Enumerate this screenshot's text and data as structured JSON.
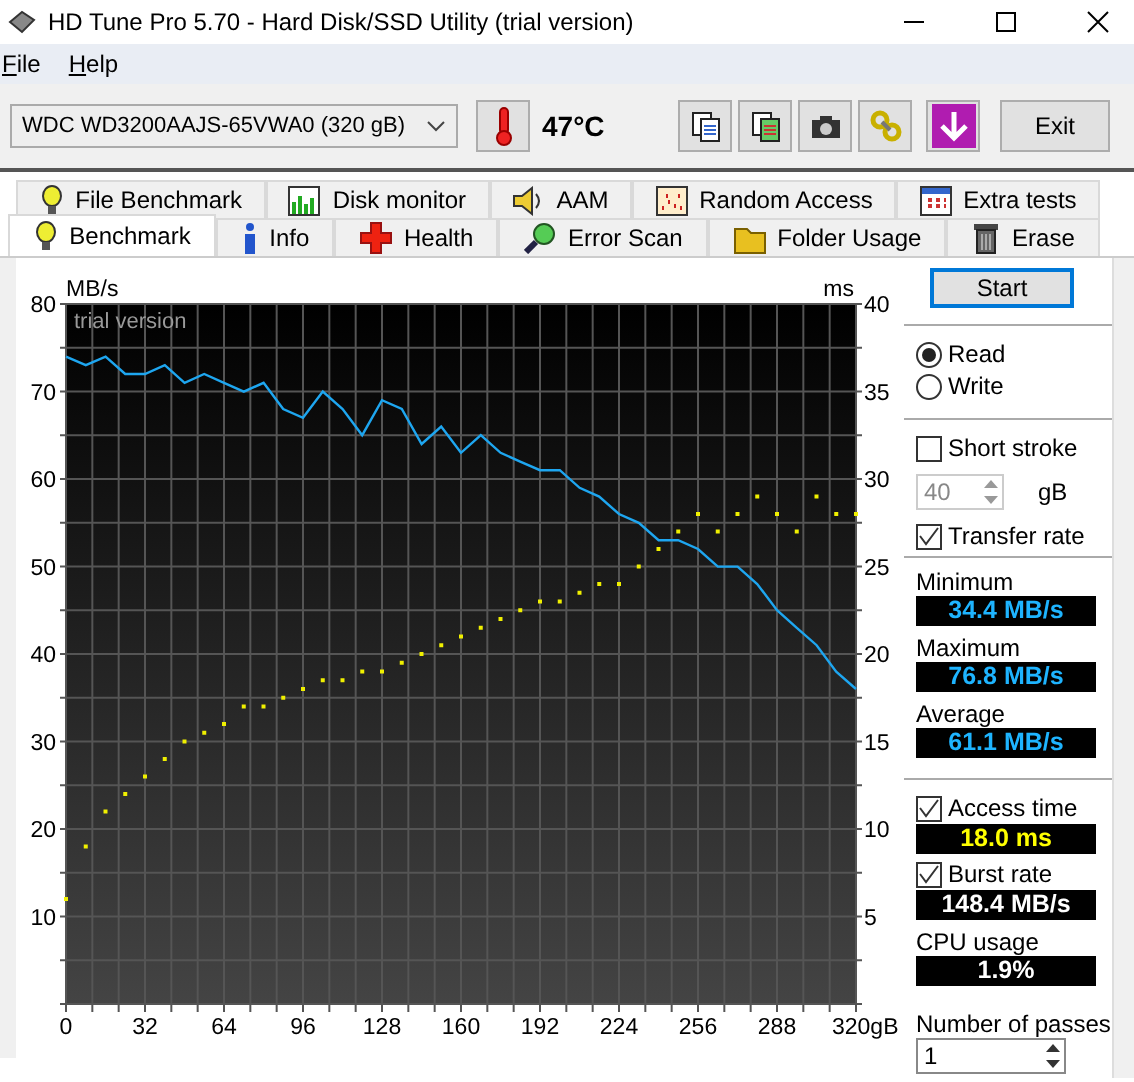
{
  "window": {
    "title": "HD Tune Pro 5.70 - Hard Disk/SSD Utility (trial version)"
  },
  "menu": [
    {
      "label": "File"
    },
    {
      "label": "Help"
    }
  ],
  "toolbar": {
    "drive": "WDC WD3200AAJS-65VWA0 (320 gB)",
    "temperature": "47°C",
    "tools": [
      {
        "kind": "copy"
      },
      {
        "kind": "copy-color"
      },
      {
        "kind": "camera"
      },
      {
        "kind": "chain"
      },
      {
        "kind": "download"
      }
    ],
    "exit": "Exit"
  },
  "tabs_back": [
    {
      "label": "File Benchmark",
      "selected": false
    },
    {
      "label": "Disk monitor",
      "selected": false
    },
    {
      "label": "AAM",
      "selected": false
    },
    {
      "label": "Random Access",
      "selected": false
    },
    {
      "label": "Extra tests",
      "selected": false
    }
  ],
  "tabs_front": [
    {
      "label": "Benchmark",
      "selected": true
    },
    {
      "label": "Info",
      "selected": false
    },
    {
      "label": "Health",
      "selected": false
    },
    {
      "label": "Error Scan",
      "selected": false
    },
    {
      "label": "Folder Usage",
      "selected": false
    },
    {
      "label": "Erase",
      "selected": false
    }
  ],
  "chart_data": {
    "type": "line",
    "grid": true,
    "ylabel": "MB/s",
    "y2label": "ms",
    "annotations": [
      {
        "text": "trial version"
      }
    ],
    "x": [
      0,
      8,
      16,
      24,
      32,
      40,
      48,
      56,
      64,
      72,
      80,
      88,
      96,
      104,
      112,
      120,
      128,
      136,
      144,
      152,
      160,
      168,
      176,
      184,
      192,
      200,
      208,
      216,
      224,
      232,
      240,
      248,
      256,
      264,
      272,
      280,
      288,
      296,
      304,
      312,
      320
    ],
    "xlim": [
      0,
      320
    ],
    "ylim": [
      0,
      80
    ],
    "y2lim": [
      0,
      40
    ],
    "xticks": [
      0,
      32,
      64,
      96,
      128,
      160,
      192,
      224,
      256,
      288,
      {
        "value": 320,
        "label": "320gB"
      }
    ],
    "yticks": [
      10,
      20,
      30,
      40,
      50,
      60,
      70,
      80
    ],
    "y2ticks": [
      5,
      10,
      15,
      20,
      25,
      30,
      35,
      40
    ],
    "series": [
      {
        "color": "#1ea6f0",
        "values": [
          74,
          73,
          74,
          72,
          72,
          73,
          71,
          72,
          71,
          70,
          71,
          68,
          67,
          70,
          68,
          65,
          69,
          68,
          64,
          66,
          63,
          65,
          63,
          62,
          61,
          61,
          59,
          58,
          56,
          55,
          53,
          53,
          52,
          50,
          50,
          48,
          45,
          43,
          41,
          38,
          36
        ]
      },
      {
        "type": "scatter",
        "axis": "y2",
        "color": "#f0f000",
        "values": [
          6,
          9,
          11,
          12,
          13,
          14,
          15,
          15.5,
          16,
          17,
          17,
          17.5,
          18,
          18.5,
          18.5,
          19,
          19,
          19.5,
          20,
          20.5,
          21,
          21.5,
          22,
          22.5,
          23,
          23,
          23.5,
          24,
          24,
          25,
          26,
          27,
          28,
          27,
          28,
          29,
          28,
          27,
          29,
          28,
          28
        ]
      }
    ]
  },
  "controls": {
    "start": "Start",
    "modes": [
      {
        "label": "Read",
        "selected": true
      },
      {
        "label": "Write",
        "selected": false
      }
    ],
    "short_stroke": {
      "label": "Short stroke",
      "checked": false,
      "value": "40",
      "unit": "gB",
      "disabled": true
    },
    "transfer_rate": {
      "label": "Transfer rate",
      "checked": true
    },
    "rates": [
      {
        "label": "Minimum",
        "value": "34.4 MB/s"
      },
      {
        "label": "Maximum",
        "value": "76.8 MB/s"
      },
      {
        "label": "Average",
        "value": "61.1 MB/s"
      }
    ],
    "extras": [
      {
        "kind": "check",
        "label": "Access time",
        "checked": true,
        "value": "18.0 ms"
      },
      {
        "kind": "check",
        "label": "Burst rate",
        "checked": true,
        "value": "148.4 MB/s"
      },
      {
        "kind": "plain",
        "label": "CPU usage",
        "value": "1.9%"
      }
    ],
    "passes": {
      "label": "Number of passes",
      "value": "1"
    }
  }
}
